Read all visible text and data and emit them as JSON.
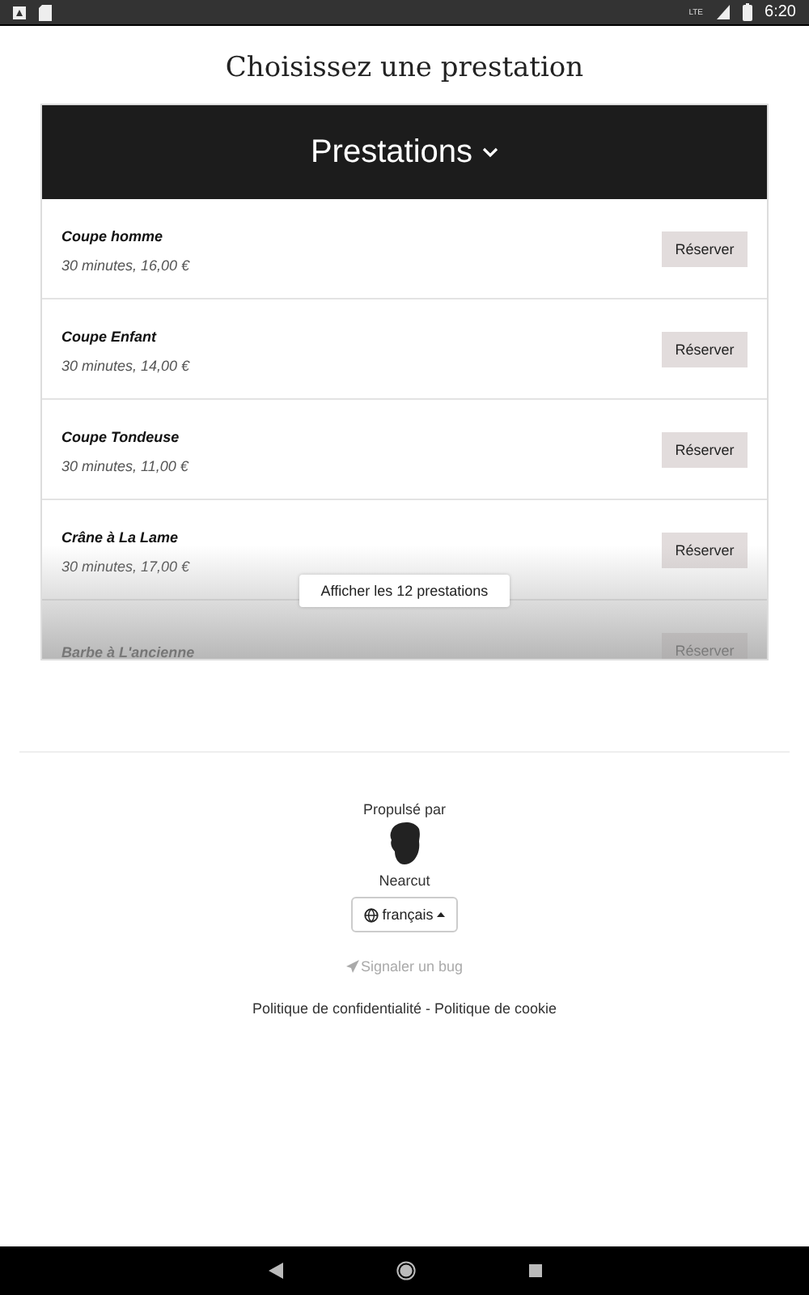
{
  "status_bar": {
    "time": "6:20",
    "network": "LTE"
  },
  "page_title": "Choisissez une prestation",
  "services_panel": {
    "title": "Prestations",
    "expanded": false,
    "services": [
      {
        "name": "Coupe homme",
        "details": "30 minutes, 16,00 €",
        "button": "Réserver"
      },
      {
        "name": "Coupe Enfant",
        "details": "30 minutes, 14,00 €",
        "button": "Réserver"
      },
      {
        "name": "Coupe Tondeuse",
        "details": "30 minutes, 11,00 €",
        "button": "Réserver"
      },
      {
        "name": "Crâne à La Lame",
        "details": "30 minutes, 17,00 €",
        "button": "Réserver"
      },
      {
        "name": "Barbe à L'ancienne",
        "button": "Réserver"
      }
    ],
    "show_all_button": "Afficher les 12 prestations"
  },
  "footer": {
    "powered_by": "Propulsé par",
    "brand": "Nearcut",
    "language": "français",
    "report_bug": "Signaler un bug",
    "policy_links": "Politique de confidentialité - Politique de cookie"
  }
}
